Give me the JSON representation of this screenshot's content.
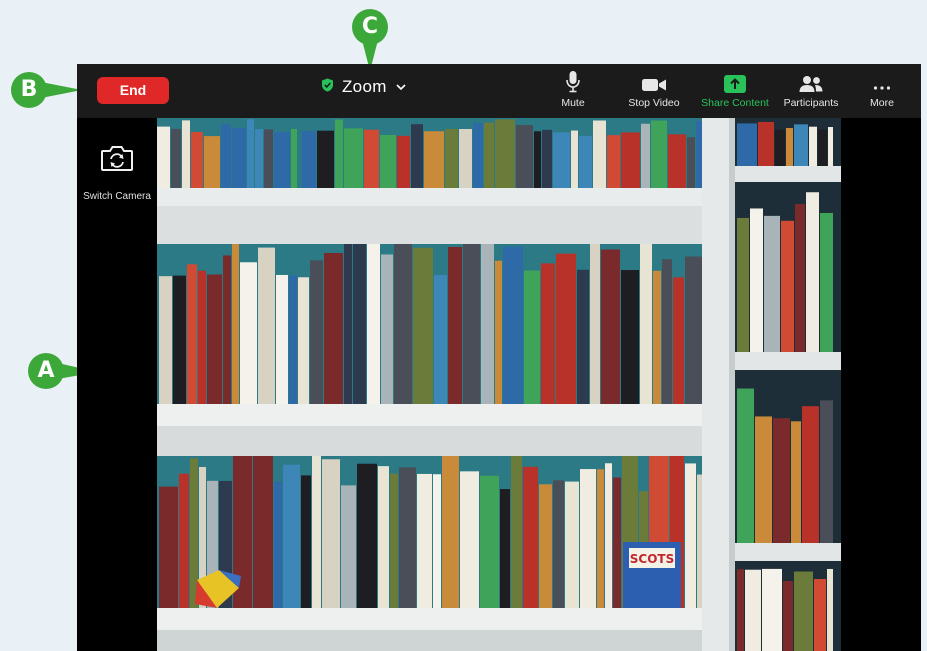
{
  "callouts": {
    "a": "A",
    "b": "B",
    "c": "C"
  },
  "toolbar": {
    "end_label": "End",
    "meeting_title": "Zoom",
    "items": [
      {
        "label": "Mute",
        "icon": "microphone-icon"
      },
      {
        "label": "Stop Video",
        "icon": "video-camera-icon"
      },
      {
        "label": "Share Content",
        "icon": "share-arrow-icon"
      },
      {
        "label": "Participants",
        "icon": "participants-icon"
      },
      {
        "label": "More",
        "icon": "more-dots-icon"
      }
    ]
  },
  "side_panel": {
    "switch_camera_label": "Switch Camera",
    "icon": "switch-camera-icon"
  },
  "video": {
    "content": "bookshelf-camera-feed",
    "book_label": "SCOTS"
  },
  "colors": {
    "callout_green": "#3da83a",
    "end_red": "#e02828",
    "share_green": "#29c25a",
    "shield_green": "#29c25a",
    "wall_teal": "#2b7a86",
    "shelf_white": "#ecefee"
  }
}
